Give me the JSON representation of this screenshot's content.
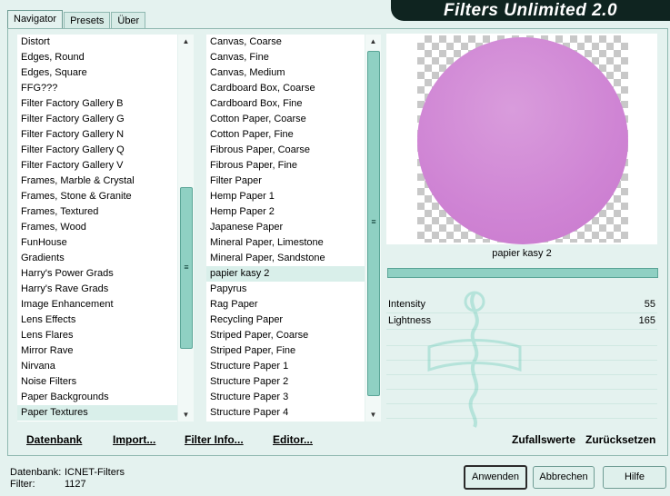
{
  "tabs": [
    "Navigator",
    "Presets",
    "Über"
  ],
  "brand": "Filters Unlimited 2.0",
  "categories": [
    "Distort",
    "Edges, Round",
    "Edges, Square",
    "FFG???",
    "Filter Factory Gallery B",
    "Filter Factory Gallery G",
    "Filter Factory Gallery N",
    "Filter Factory Gallery Q",
    "Filter Factory Gallery V",
    "Frames, Marble & Crystal",
    "Frames, Stone & Granite",
    "Frames, Textured",
    "Frames, Wood",
    "FunHouse",
    "Gradients",
    "Harry's Power Grads",
    "Harry's Rave Grads",
    "Image Enhancement",
    "Lens Effects",
    "Lens Flares",
    "Mirror Rave",
    "Nirvana",
    "Noise Filters",
    "Paper Backgrounds",
    "Paper Textures"
  ],
  "categories_selected": 24,
  "filters": [
    "Canvas, Coarse",
    "Canvas, Fine",
    "Canvas, Medium",
    "Cardboard Box, Coarse",
    "Cardboard Box, Fine",
    "Cotton Paper, Coarse",
    "Cotton Paper, Fine",
    "Fibrous Paper, Coarse",
    "Fibrous Paper, Fine",
    "Filter Paper",
    "Hemp Paper 1",
    "Hemp Paper 2",
    "Japanese Paper",
    "Mineral Paper, Limestone",
    "Mineral Paper, Sandstone",
    "papier kasy 2",
    "Papyrus",
    "Rag Paper",
    "Recycling Paper",
    "Striped Paper, Coarse",
    "Striped Paper, Fine",
    "Structure Paper 1",
    "Structure Paper 2",
    "Structure Paper 3",
    "Structure Paper 4"
  ],
  "filters_selected": 15,
  "preview": {
    "filter_name": "papier kasy 2",
    "circle_color": "#cf84d4"
  },
  "params": [
    {
      "name": "Intensity",
      "value": "55"
    },
    {
      "name": "Lightness",
      "value": "165"
    }
  ],
  "toolbar": {
    "datenbank": "Datenbank",
    "import": "Import...",
    "filter_info": "Filter Info...",
    "editor": "Editor...",
    "random": "Zufallswerte",
    "reset": "Zurücksetzen"
  },
  "status": {
    "db_label": "Datenbank:",
    "db_value": "ICNET-Filters",
    "filter_label": "Filter:",
    "filter_value": "1127"
  },
  "buttons": {
    "apply": "Anwenden",
    "cancel": "Abbrechen",
    "help": "Hilfe"
  },
  "colors": {
    "accent": "#8fd0c3",
    "background": "#e4f2ef",
    "brand_bg": "#0f2420"
  }
}
